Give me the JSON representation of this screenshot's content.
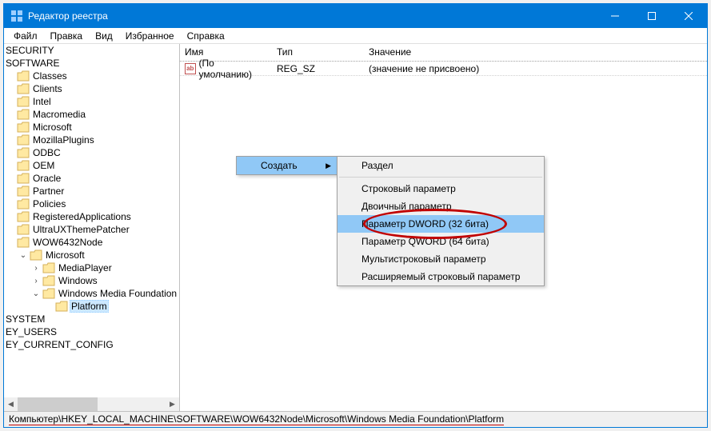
{
  "window": {
    "title": "Редактор реестра"
  },
  "menu": {
    "file": "Файл",
    "edit": "Правка",
    "view": "Вид",
    "favorites": "Избранное",
    "help": "Справка"
  },
  "tree": {
    "security": "SECURITY",
    "software": "SOFTWARE",
    "classes": "Classes",
    "clients": "Clients",
    "intel": "Intel",
    "macromedia": "Macromedia",
    "microsoft": "Microsoft",
    "mozillaplugins": "MozillaPlugins",
    "odbc": "ODBC",
    "oem": "OEM",
    "oracle": "Oracle",
    "partner": "Partner",
    "policies": "Policies",
    "registeredapps": "RegisteredApplications",
    "ultraux": "UltraUXThemePatcher",
    "wow64": "WOW6432Node",
    "microsoft2": "Microsoft",
    "mediaplayer": "MediaPlayer",
    "windows": "Windows",
    "wmf": "Windows Media Foundation",
    "platform": "Platform",
    "system": "SYSTEM",
    "users": "EY_USERS",
    "curconf": "EY_CURRENT_CONFIG"
  },
  "list": {
    "col_name": "Имя",
    "col_type": "Тип",
    "col_value": "Значение",
    "row0": {
      "name": "(По умолчанию)",
      "type": "REG_SZ",
      "value": "(значение не присвоено)"
    }
  },
  "ctx": {
    "create": "Создать",
    "section": "Раздел",
    "string": "Строковый параметр",
    "binary": "Двоичный параметр",
    "dword": "Параметр DWORD (32 бита)",
    "qword": "Параметр QWORD (64 бита)",
    "multi": "Мультистроковый параметр",
    "expand": "Расширяемый строковый параметр"
  },
  "status": {
    "path": "Компьютер\\HKEY_LOCAL_MACHINE\\SOFTWARE\\WOW6432Node\\Microsoft\\Windows Media Foundation\\Platform"
  }
}
